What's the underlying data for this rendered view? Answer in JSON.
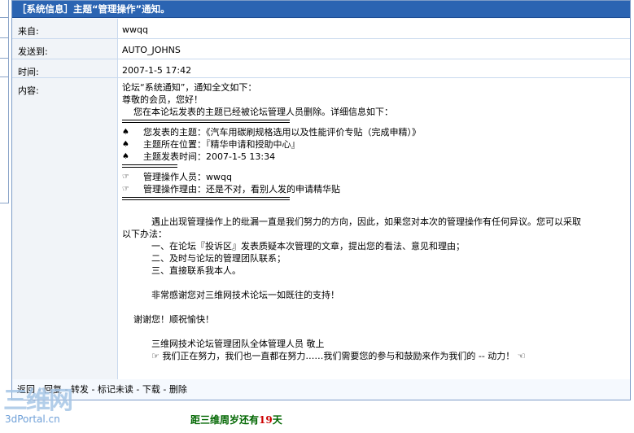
{
  "title": "［系统信息］主题“管理操作”通知。",
  "fields": {
    "from": {
      "label": "来自:",
      "value": "wwqq"
    },
    "to": {
      "label": "发送到:",
      "value": "AUTO_JOHNS"
    },
    "time": {
      "label": "时间:",
      "value": "2007-1-5 17:42"
    },
    "content": {
      "label": "内容:"
    }
  },
  "message": {
    "intro1": "论坛“系统通知”，通知全文如下：",
    "intro2": "尊敬的会员，您好！",
    "intro3": "您在本论坛发表的主题已经被论坛管理人员删除。详细信息如下：",
    "topic_items": [
      {
        "icon": "♠",
        "icon_name": "spade-icon",
        "text": "您发表的主题：《汽车用碳刷规格选用以及性能评价专贴（完成申精）》"
      },
      {
        "icon": "♠",
        "icon_name": "spade-icon",
        "text": "主题所在位置：『精华申请和授助中心』"
      },
      {
        "icon": "♠",
        "icon_name": "spade-icon",
        "text": "主题发表时间：2007-1-5 13:34"
      }
    ],
    "admin_items": [
      {
        "icon": "☞",
        "icon_name": "pointing-hand-icon",
        "text": "管理操作人员：wwqq"
      },
      {
        "icon": "☞",
        "icon_name": "pointing-hand-icon",
        "text": "管理操作理由：还是不对，看别人发的申请精华贴"
      }
    ],
    "para1": "遇止出现管理操作上的纰漏一直是我们努力的方向，因此，如果您对本次的管理操作有任何异议。您可以采取",
    "para1b": "以下办法：",
    "options": [
      "一、在论坛『投诉区』发表质疑本次管理的文章，提出您的看法、意见和理由；",
      "二、及时与论坛的管理团队联系；",
      "三、直接联系我本人。"
    ],
    "thanks1": "非常感谢您对三维网技术论坛一如既往的支持！",
    "thanks2": "谢谢您！顺祝愉快！",
    "sign": "三维网技术论坛管理团队全体管理人员 敬上",
    "slogan": "☞ 我们正在努力，我们也一直都在努力……我们需要您的参与和鼓励来作为我们的 -- 动力！ ☜"
  },
  "actions": {
    "reply_back": "返回",
    "reply": "回复",
    "forward": "转发",
    "mark_unread": "标记未读",
    "download": "下载",
    "delete": "删除"
  },
  "watermark": {
    "big": "三维网",
    "small": "3dPortal.cn"
  },
  "countdown": {
    "prefix": "距三维周岁还有",
    "days": "19",
    "suffix": "天"
  }
}
